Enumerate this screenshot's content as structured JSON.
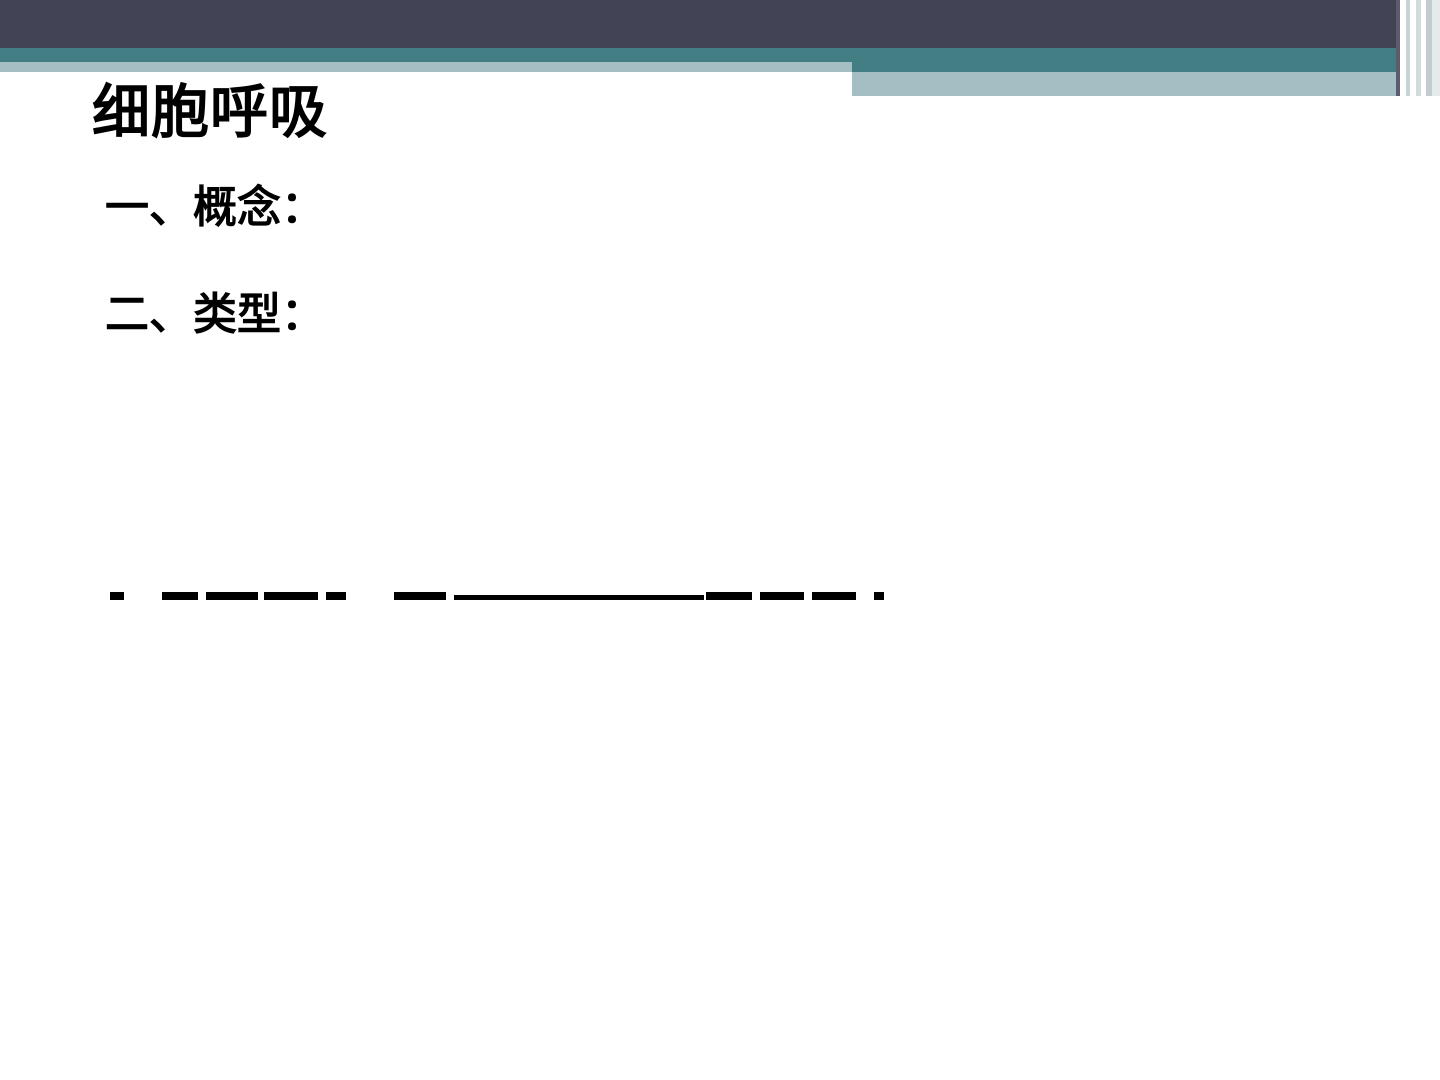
{
  "slide": {
    "title": "细胞呼吸",
    "sections": [
      {
        "label": "一、概念："
      },
      {
        "label": "二、类型："
      }
    ]
  },
  "colors": {
    "header_dark": "#434356",
    "header_teal": "#447e85",
    "header_pale": "#a4bfc4",
    "text": "#000000",
    "background": "#ffffff"
  }
}
